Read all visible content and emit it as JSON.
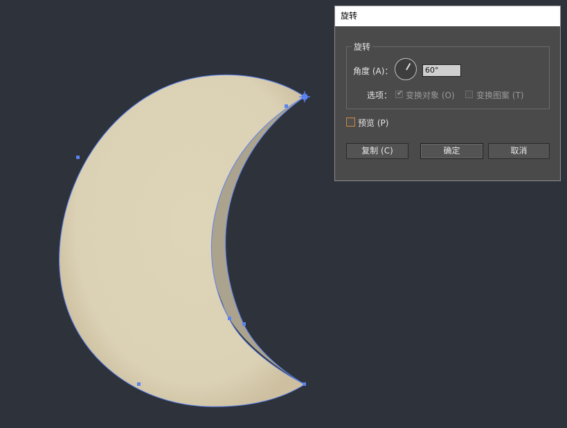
{
  "dialog": {
    "title": "旋转",
    "group_title": "旋转",
    "angle_label": "角度 (A)：",
    "angle_value": "60°",
    "dial_icon": "rotation-dial-icon",
    "options_label": "选项：",
    "option_transform_objects": {
      "label": "变换对象 (O)",
      "checked": true,
      "enabled": false
    },
    "option_transform_patterns": {
      "label": "变换图案 (T)",
      "checked": false,
      "enabled": false
    },
    "preview": {
      "label": "预览 (P)",
      "checked": false
    },
    "buttons": {
      "copy": "复制 (C)",
      "ok": "确定",
      "cancel": "取消"
    }
  },
  "artboard": {
    "background": "#2e323b",
    "shape": "crescent-moon",
    "fill": "#dcd3b8",
    "inner_edge": "#aba38e",
    "selection_color": "#5a82f0"
  }
}
